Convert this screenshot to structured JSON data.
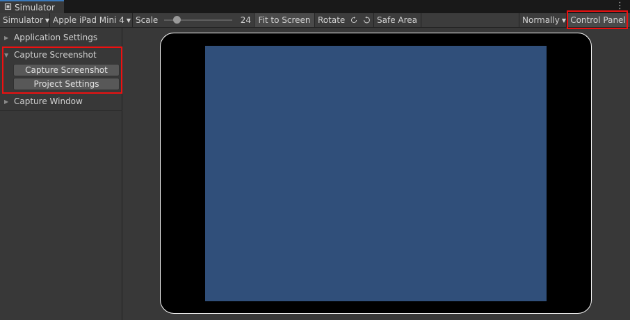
{
  "window": {
    "tab_title": "Simulator",
    "menu_glyph": "⋮"
  },
  "toolbar": {
    "mode": "Simulator",
    "device": "Apple iPad Mini 4",
    "scale_label": "Scale",
    "scale_value": "24",
    "fit_label": "Fit to Screen",
    "rotate_label": "Rotate",
    "safe_area_label": "Safe Area",
    "normally_label": "Normally",
    "control_panel_label": "Control Panel"
  },
  "sidebar": {
    "sections": [
      {
        "label": "Application Settings",
        "expanded": false
      },
      {
        "label": "Capture Screenshot",
        "expanded": true,
        "buttons": [
          "Capture Screenshot",
          "Project Settings"
        ]
      },
      {
        "label": "Capture Window",
        "expanded": false
      }
    ]
  },
  "colors": {
    "highlight": "#ee1010",
    "screen": "#304f7a",
    "device_bezel": "#000000",
    "tab_accent": "#3a79bb"
  }
}
